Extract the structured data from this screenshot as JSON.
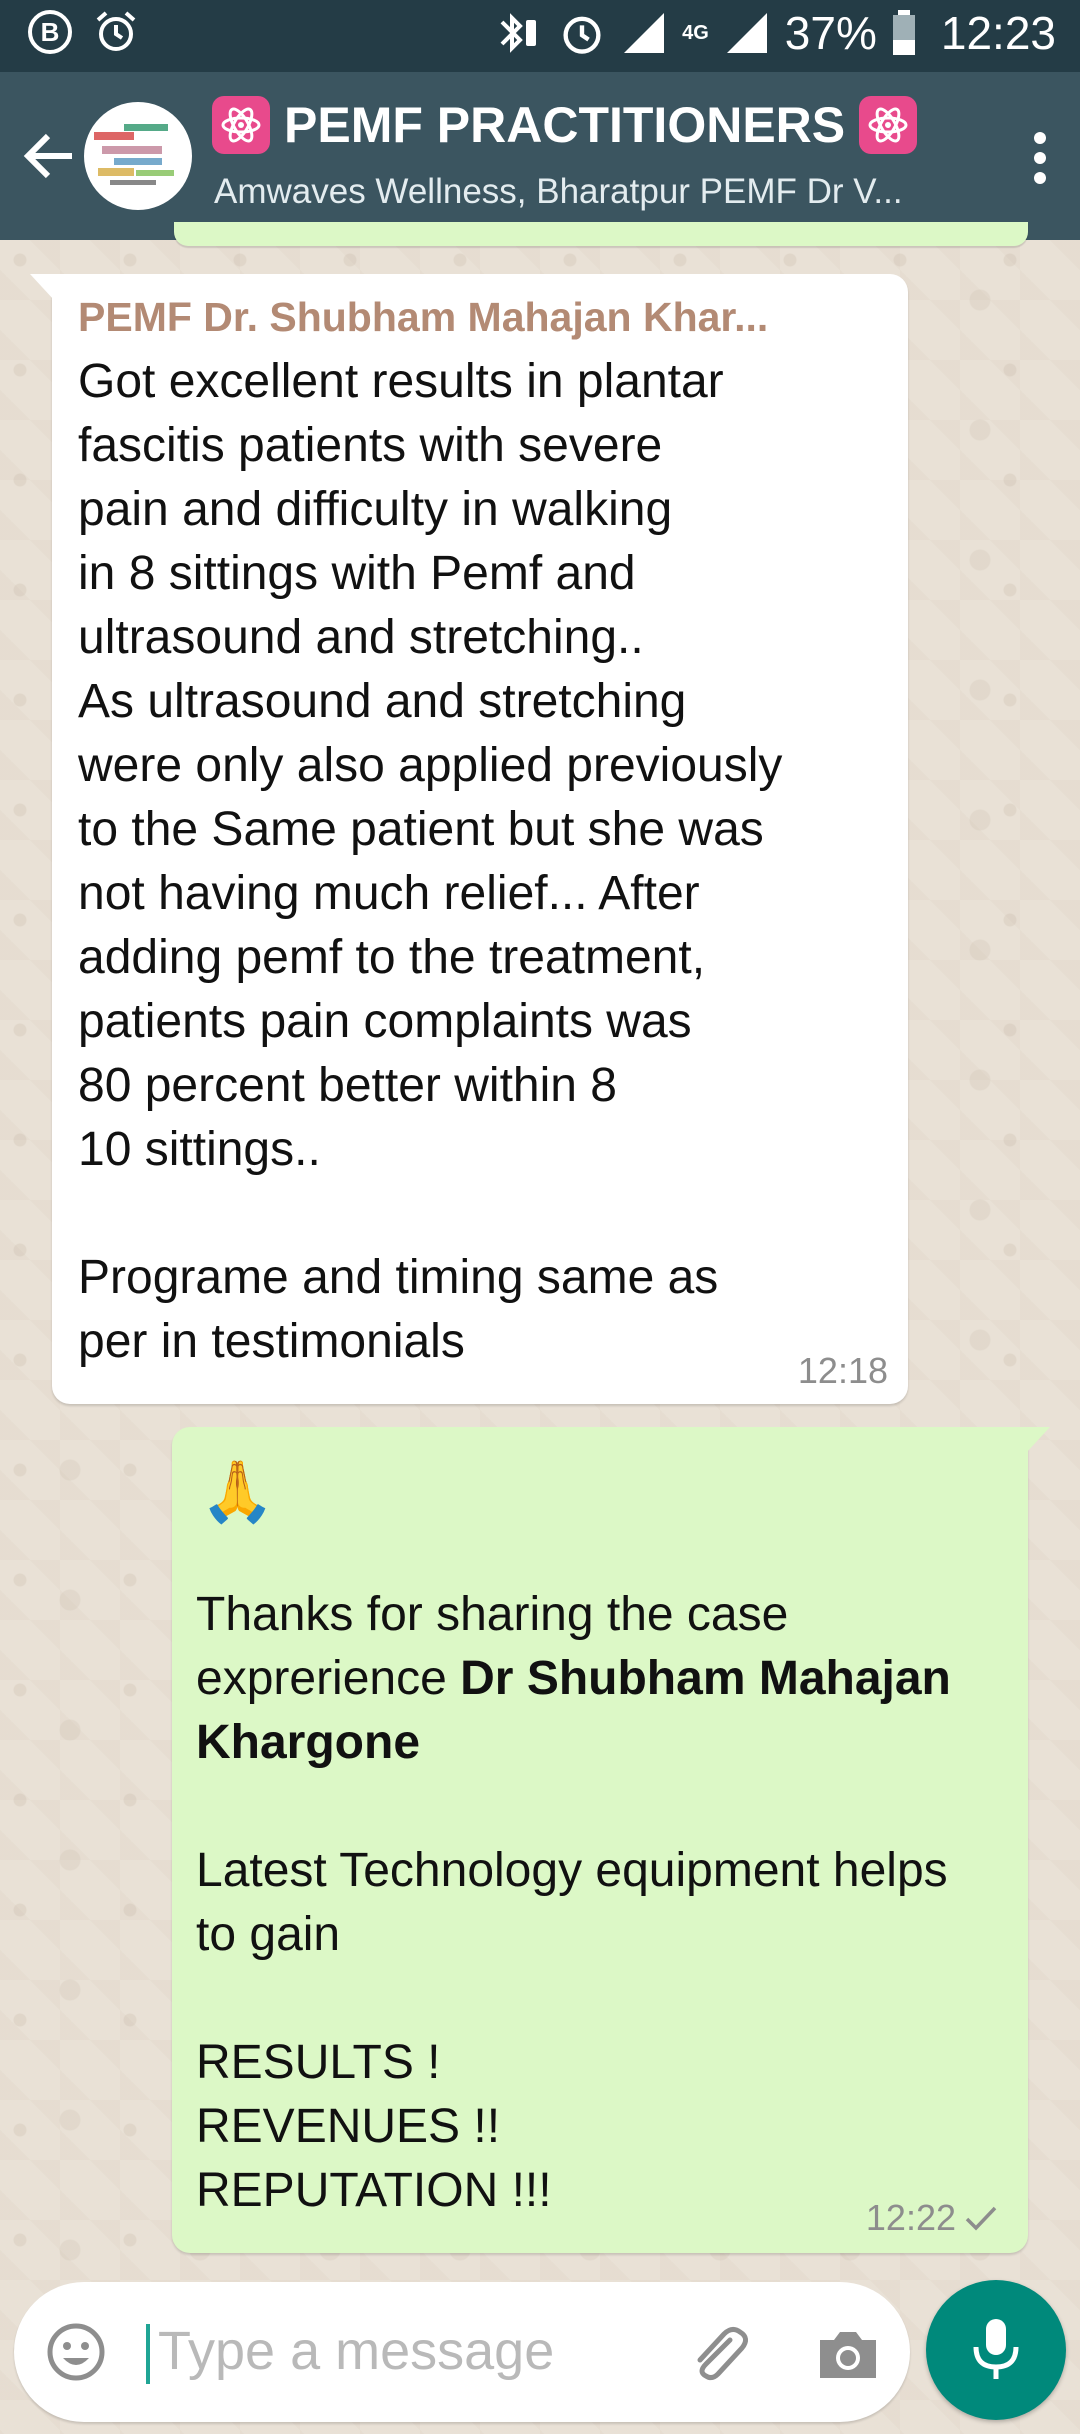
{
  "status_bar": {
    "b_icon_letter": "B",
    "network_label": "4G",
    "battery": "37%",
    "time": "12:23"
  },
  "header": {
    "title": "PEMF PRACTITIONERS",
    "subtitle": "Amwaves Wellness, Bharatpur PEMF Dr V..."
  },
  "messages": {
    "incoming": {
      "sender": "PEMF Dr. Shubham Mahajan Khar...",
      "text": "Got excellent results in plantar\nfascitis patients with severe\npain and difficulty in walking\nin 8 sittings with Pemf and\nultrasound and stretching..\nAs ultrasound and stretching\nwere only also applied previously\nto the Same patient but she was\nnot having much relief... After\nadding pemf to the treatment,\npatients pain complaints was\n80 percent better within 8\n10 sittings..\n\nPrograme and timing same as\nper in testimonials",
      "time": "12:18"
    },
    "outgoing": {
      "emoji": "🙏",
      "thanks_plain": "Thanks for sharing the case exprerience ",
      "thanks_bold": "Dr Shubham Mahajan Khargone",
      "line2": "Latest Technology equipment helps to gain",
      "result1": "RESULTS !",
      "result2": "REVENUES !!",
      "result3": "REPUTATION !!!",
      "time": "12:22",
      "status_icon": "single-check-icon"
    }
  },
  "input": {
    "placeholder": "Type a message"
  },
  "colors": {
    "app_bar": "#3B5560",
    "status_bar": "#243C46",
    "outgoing_bubble": "#DCF8C6",
    "sender_name": "#B38A74",
    "mic_button": "#00897B"
  }
}
